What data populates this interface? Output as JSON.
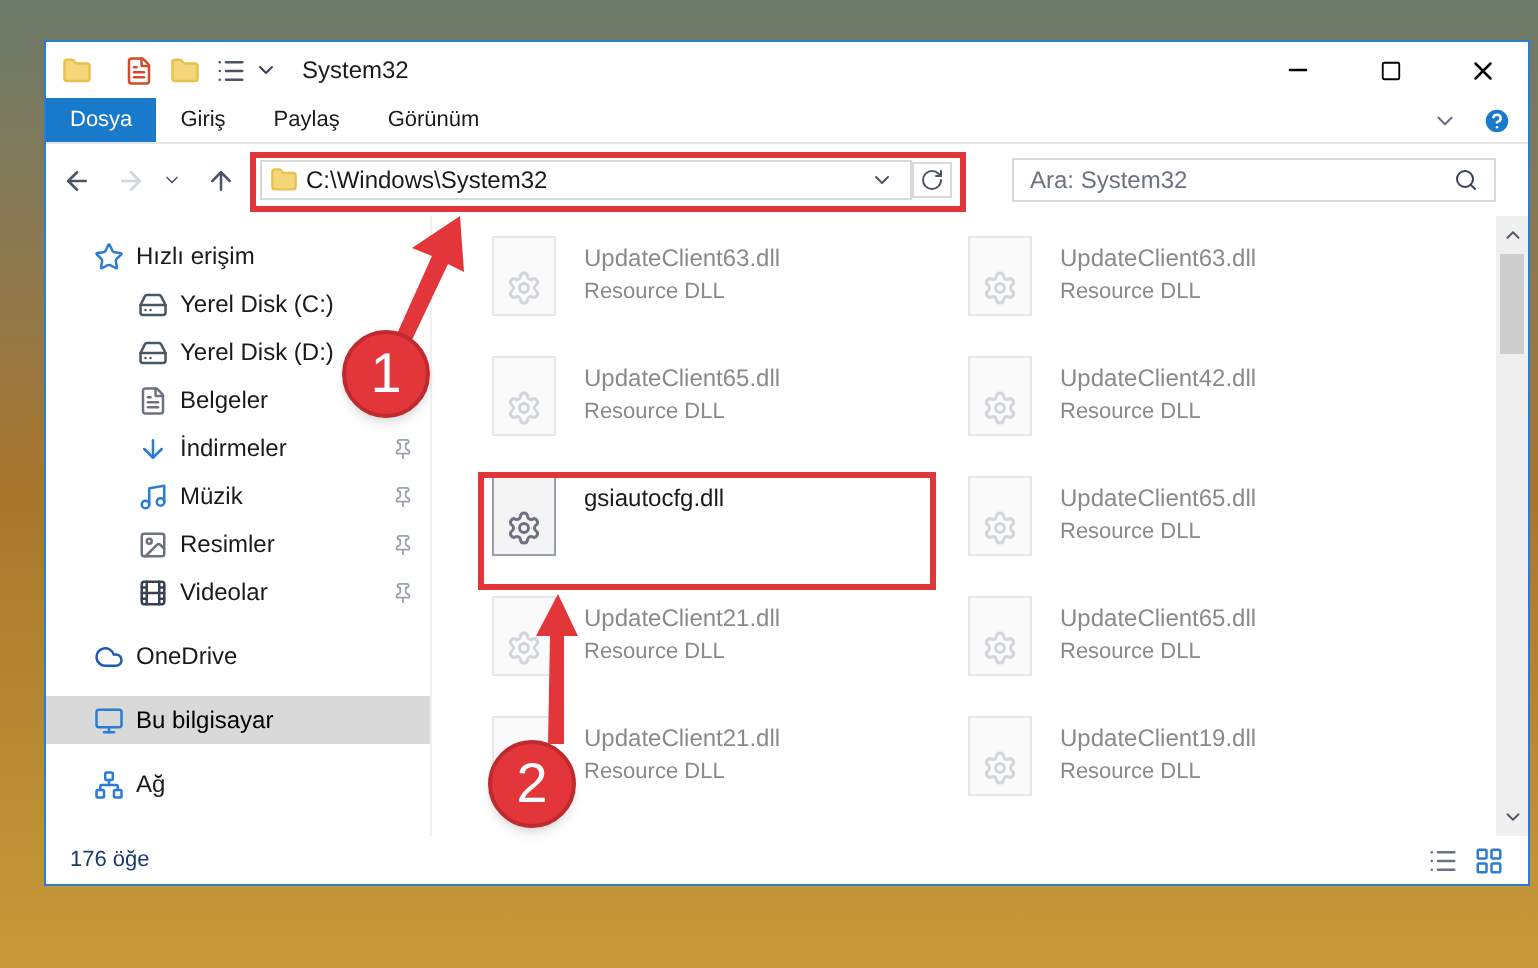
{
  "window": {
    "title": "System32"
  },
  "ribbon_tabs": [
    {
      "label": "Dosya",
      "selected": true
    },
    {
      "label": "Giriş",
      "selected": false
    },
    {
      "label": "Paylaş",
      "selected": false
    },
    {
      "label": "Görünüm",
      "selected": false
    }
  ],
  "address_bar": {
    "path": "C:\\Windows\\System32"
  },
  "search": {
    "placeholder": "Ara: System32"
  },
  "sidebar": {
    "items": [
      {
        "label": "Hızlı erişim",
        "kind": "star",
        "pinned": false,
        "selected": false,
        "children": [
          {
            "label": "Yerel Disk (C:)",
            "kind": "drive",
            "pinned": false,
            "selected": false
          },
          {
            "label": "Yerel Disk (D:)",
            "kind": "drive",
            "pinned": false,
            "selected": false
          },
          {
            "label": "Belgeler",
            "kind": "document",
            "pinned": false,
            "selected": false
          },
          {
            "label": "İndirmeler",
            "kind": "download",
            "pinned": true,
            "selected": false
          },
          {
            "label": "Müzik",
            "kind": "music",
            "pinned": true,
            "selected": false
          },
          {
            "label": "Resimler",
            "kind": "picture",
            "pinned": true,
            "selected": false
          },
          {
            "label": "Videolar",
            "kind": "video",
            "pinned": true,
            "selected": false
          }
        ]
      },
      {
        "label": "OneDrive",
        "kind": "cloud",
        "pinned": false,
        "selected": false
      },
      {
        "label": "Bu bilgisayar",
        "kind": "computer",
        "pinned": false,
        "selected": true
      },
      {
        "label": "Ağ",
        "kind": "network",
        "pinned": false,
        "selected": false
      }
    ]
  },
  "files": [
    {
      "name": "UpdateClient63.dll",
      "type": "Resource DLL",
      "blurred": true
    },
    {
      "name": "UpdateClient63.dll",
      "type": "Resource DLL",
      "blurred": true
    },
    {
      "name": "UpdateClient65.dll",
      "type": "Resource DLL",
      "blurred": true
    },
    {
      "name": "UpdateClient42.dll",
      "type": "Resource DLL",
      "blurred": true
    },
    {
      "name": "gsiautocfg.dll",
      "blurred": false
    },
    {
      "name": "UpdateClient65.dll",
      "type": "Resource DLL",
      "blurred": true
    },
    {
      "name": "UpdateClient21.dll",
      "type": "Resource DLL",
      "blurred": true
    },
    {
      "name": "UpdateClient65.dll",
      "type": "Resource DLL",
      "blurred": true
    },
    {
      "name": "UpdateClient21.dll",
      "type": "Resource DLL",
      "blurred": true
    },
    {
      "name": "UpdateClient19.dll",
      "type": "Resource DLL",
      "blurred": true
    }
  ],
  "status_bar": {
    "count": "176 öğe"
  },
  "annotations": [
    {
      "number": "1"
    },
    {
      "number": "2"
    }
  ]
}
